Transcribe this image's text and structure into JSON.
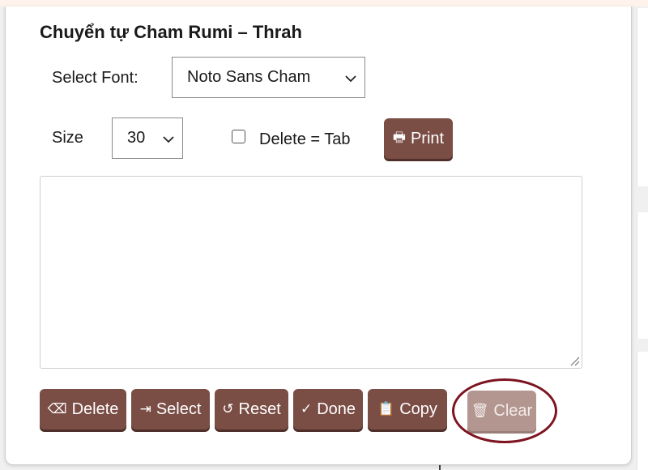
{
  "title": "Chuyển tự Cham Rumi – Thrah",
  "font_select": {
    "label": "Select Font:",
    "value": "Noto Sans Cham"
  },
  "size_select": {
    "label": "Size",
    "value": "30"
  },
  "delete_tab": {
    "label": "Delete = Tab",
    "checked": false
  },
  "print_button": {
    "label": "Print",
    "icon": "printer-icon",
    "glyph": "🖶"
  },
  "editor": {
    "value": ""
  },
  "actions": {
    "delete": {
      "label": "Delete",
      "icon": "backspace-icon",
      "glyph": "⌫"
    },
    "select": {
      "label": "Select",
      "icon": "tab-arrow-icon",
      "glyph": "⇥"
    },
    "reset": {
      "label": "Reset",
      "icon": "reset-icon",
      "glyph": "↺"
    },
    "done": {
      "label": "Done",
      "icon": "check-icon",
      "glyph": "✓"
    },
    "copy": {
      "label": "Copy",
      "icon": "clipboard-icon",
      "glyph": "📋"
    },
    "clear": {
      "label": "Clear",
      "icon": "trash-icon",
      "glyph": "🗑",
      "disabled": true
    }
  },
  "colors": {
    "button": "#7a4d45",
    "button_disabled": "#b3968f",
    "highlight_circle": "#7d1420"
  }
}
